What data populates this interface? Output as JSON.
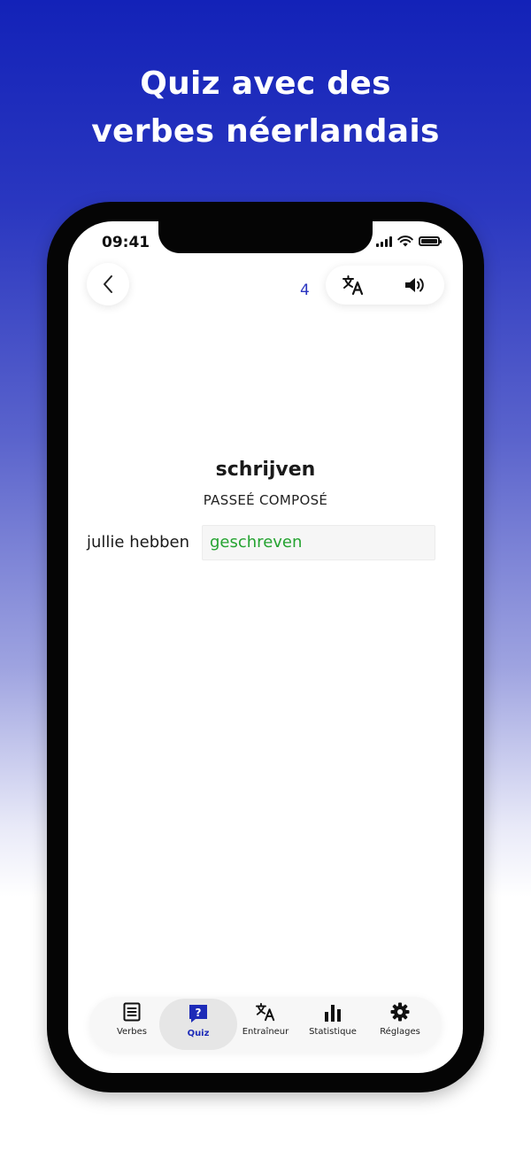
{
  "headline": {
    "line1": "Quiz avec des",
    "line2": "verbes néerlandais"
  },
  "status_bar": {
    "time": "09:41"
  },
  "header": {
    "counter": "4",
    "translate_icon": "translate-icon",
    "sound_icon": "speaker-icon",
    "back_icon": "chevron-left-icon"
  },
  "quiz": {
    "verb": "schrijven",
    "tense": "PASSEÉ COMPOSÉ",
    "pronoun": "jullie hebben",
    "answer": "geschreven"
  },
  "tabs": [
    {
      "label": "Verbes",
      "icon": "list-icon"
    },
    {
      "label": "Quiz",
      "icon": "quiz-icon",
      "active": true
    },
    {
      "label": "Entraîneur",
      "icon": "translate-icon"
    },
    {
      "label": "Statistique",
      "icon": "bar-chart-icon"
    },
    {
      "label": "Réglages",
      "icon": "gear-icon"
    }
  ],
  "colors": {
    "accent": "#1d2bb8",
    "correct": "#25a331",
    "background_top": "#1322b8"
  }
}
